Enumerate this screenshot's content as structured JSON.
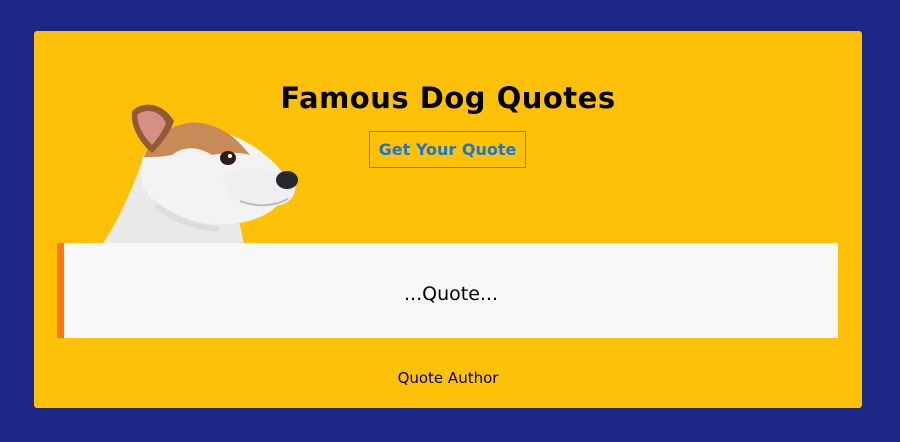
{
  "page": {
    "title": "Famous Dog Quotes",
    "button_label": "Get Your Quote",
    "quote_text": "...Quote...",
    "author_text": "Quote Author"
  },
  "colors": {
    "background": "#1d2785",
    "card": "#ffc107",
    "button_text": "#1976d2",
    "button_border": "#4f7fae",
    "quote_box": "#f8f8f8",
    "quote_accent": "#ff7800"
  },
  "image": {
    "icon": "dog-head-illustration"
  }
}
